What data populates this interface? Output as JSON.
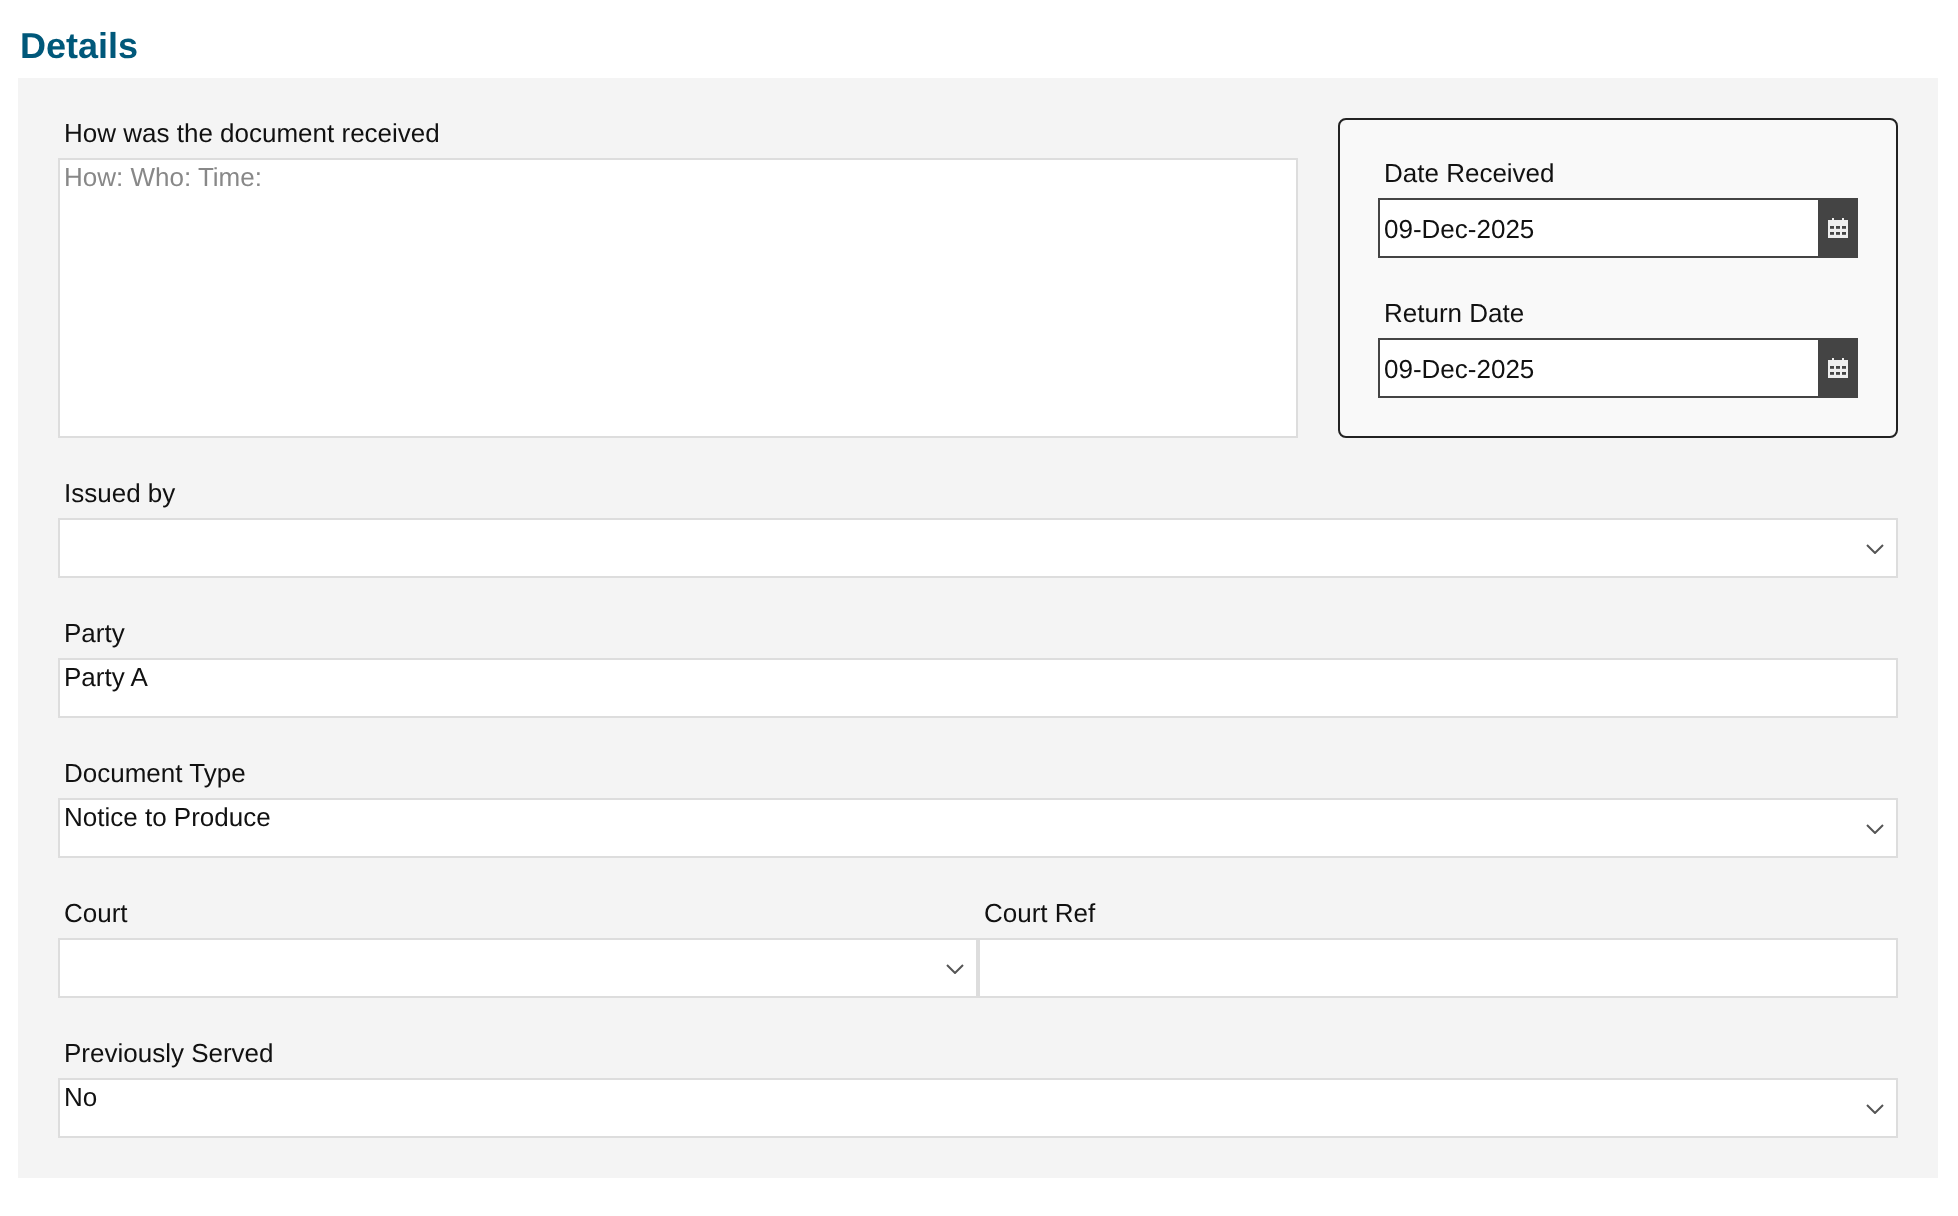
{
  "title": "Details",
  "received": {
    "label": "How was the document received",
    "placeholder": "How: Who: Time:"
  },
  "dates": [
    {
      "label": "Date Received",
      "value": "09-Dec-2025"
    },
    {
      "label": "Return Date",
      "value": "09-Dec-2025"
    }
  ],
  "rows": [
    [
      {
        "kind": "select",
        "label": "Issued by"
      }
    ],
    [
      {
        "kind": "text",
        "label": "Party",
        "value": "Party A"
      }
    ],
    [
      {
        "kind": "select",
        "label": "Document Type",
        "value": "Notice to Produce"
      }
    ],
    [
      {
        "kind": "select",
        "label": "Court"
      },
      {
        "kind": "text",
        "label": "Court Ref"
      }
    ],
    [
      {
        "kind": "select",
        "label": "Previously Served",
        "value": "No"
      }
    ]
  ]
}
